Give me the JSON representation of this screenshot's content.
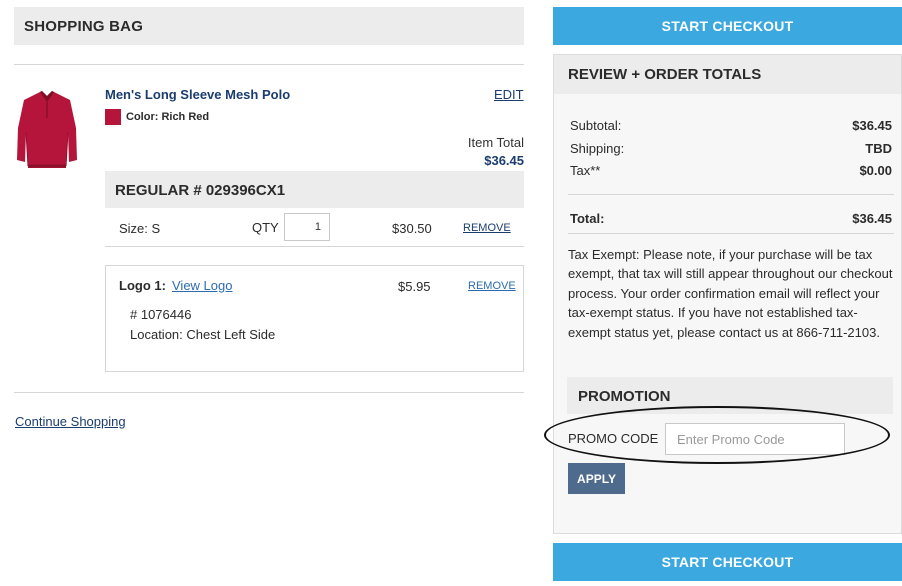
{
  "bag": {
    "title": "SHOPPING BAG",
    "product": {
      "name": "Men's Long Sleeve Mesh Polo",
      "edit_label": "EDIT",
      "color_label": "Color: Rich Red",
      "color_hex": "#b5153a",
      "item_total_label": "Item Total",
      "item_total": "$36.45",
      "regular_label": "REGULAR # 029396CX1",
      "size_label": "Size: S",
      "qty_label": "QTY",
      "qty_value": "1",
      "line_price": "$30.50",
      "remove_label": "REMOVE",
      "logo": {
        "label": "Logo 1:",
        "view_link": "View Logo",
        "price": "$5.95",
        "remove_label": "REMOVE",
        "number": "# 1076446",
        "location": "Location: Chest Left Side"
      }
    },
    "continue_label": "Continue Shopping"
  },
  "checkout": {
    "start_label": "START CHECKOUT",
    "review_title": "REVIEW + ORDER TOTALS",
    "rows": [
      {
        "label": "Subtotal:",
        "value": "$36.45"
      },
      {
        "label": "Shipping:",
        "value": "TBD"
      },
      {
        "label": "Tax**",
        "value": "$0.00"
      }
    ],
    "total_label": "Total:",
    "total_value": "$36.45",
    "tax_note": "Tax Exempt: Please note, if your purchase will be tax exempt, that tax will still appear throughout our checkout process. Your order confirmation email will reflect your tax-exempt status. If you have not established tax-exempt status yet, please contact us at 866-711-2103.",
    "promo_title": "PROMOTION",
    "promo_label": "PROMO CODE",
    "promo_placeholder": "Enter Promo Code",
    "apply_label": "APPLY"
  },
  "colors": {
    "accent_blue": "#3ba8e0",
    "link_navy": "#1b3d6e",
    "apply_slate": "#4e6a8c"
  }
}
